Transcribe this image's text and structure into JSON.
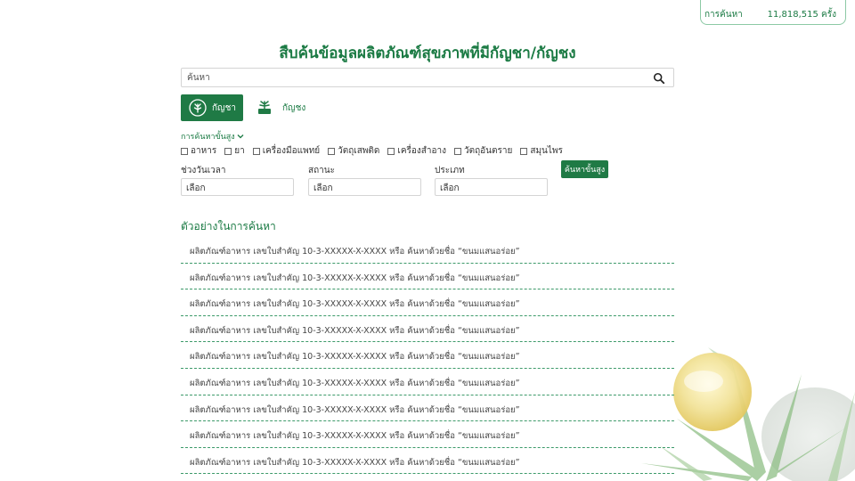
{
  "stats": {
    "row1_value": "",
    "row2_label": "การค้นหา",
    "row2_value": "11,818,515 ครั้ง"
  },
  "title": "สืบค้นข้อมูลผลิตภัณฑ์สุขภาพที่มีกัญชา/กัญชง",
  "search": {
    "placeholder": "ค้นหา",
    "value": ""
  },
  "tabs": [
    {
      "label": "กัญชา",
      "icon": "cannabis-leaf-icon",
      "active": true
    },
    {
      "label": "กัญชง",
      "icon": "hemp-plant-icon",
      "active": false
    }
  ],
  "advanced_toggle": "การค้นหาขั้นสูง",
  "categories": [
    "อาหาร",
    "ยา",
    "เครื่องมือแพทย์",
    "วัตถุเสพติด",
    "เครื่องสำอาง",
    "วัตถุอันตราย",
    "สมุนไพร"
  ],
  "filters": {
    "date": {
      "label": "ช่วงวันเวลา",
      "value": "เลือก"
    },
    "status": {
      "label": "สถานะ",
      "value": "เลือก"
    },
    "type": {
      "label": "ประเภท",
      "value": "เลือก"
    }
  },
  "advanced_button": "ค้นหาขั้นสูง",
  "examples": {
    "title": "ตัวอย่างในการค้นหา",
    "items": [
      "ผลิตภัณฑ์อาหาร เลขใบสำคัญ 10-3-XXXXX-X-XXXX หรือ ค้นหาด้วยชื่อ “ขนมแสนอร่อย”",
      "ผลิตภัณฑ์อาหาร เลขใบสำคัญ 10-3-XXXXX-X-XXXX หรือ ค้นหาด้วยชื่อ “ขนมแสนอร่อย”",
      "ผลิตภัณฑ์อาหาร เลขใบสำคัญ 10-3-XXXXX-X-XXXX หรือ ค้นหาด้วยชื่อ “ขนมแสนอร่อย”",
      "ผลิตภัณฑ์อาหาร เลขใบสำคัญ 10-3-XXXXX-X-XXXX หรือ ค้นหาด้วยชื่อ “ขนมแสนอร่อย”",
      "ผลิตภัณฑ์อาหาร เลขใบสำคัญ 10-3-XXXXX-X-XXXX หรือ ค้นหาด้วยชื่อ “ขนมแสนอร่อย”",
      "ผลิตภัณฑ์อาหาร เลขใบสำคัญ 10-3-XXXXX-X-XXXX หรือ ค้นหาด้วยชื่อ “ขนมแสนอร่อย”",
      "ผลิตภัณฑ์อาหาร เลขใบสำคัญ 10-3-XXXXX-X-XXXX หรือ ค้นหาด้วยชื่อ “ขนมแสนอร่อย”",
      "ผลิตภัณฑ์อาหาร เลขใบสำคัญ 10-3-XXXXX-X-XXXX หรือ ค้นหาด้วยชื่อ “ขนมแสนอร่อย”",
      "ผลิตภัณฑ์อาหาร เลขใบสำคัญ 10-3-XXXXX-X-XXXX หรือ ค้นหาด้วยชื่อ “ขนมแสนอร่อย”"
    ]
  },
  "colors": {
    "brand_green": "#1f7a45",
    "text_green": "#1a7a43",
    "divider": "#3d9a6a"
  }
}
